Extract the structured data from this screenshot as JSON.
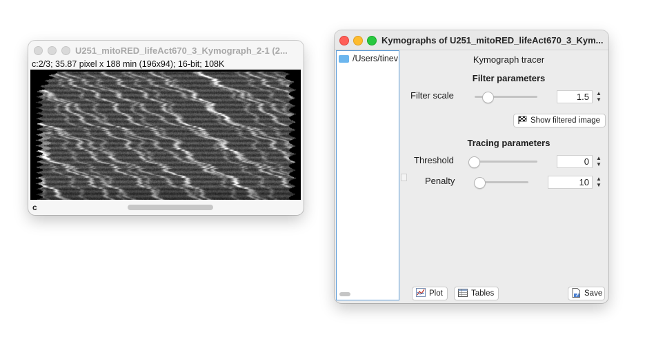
{
  "image_window": {
    "title": "U251_mitoRED_lifeAct670_3_Kymograph_2-1 (2...",
    "info": "c:2/3; 35.87 pixel x 188 min (196x94); 16-bit; 108K",
    "channel_label": "c"
  },
  "tracer_window": {
    "title": "Kymographs of U251_mitoRED_lifeAct670_3_Kym...",
    "tree_path": "/Users/tinev",
    "heading": "Kymograph tracer",
    "filter": {
      "section_title": "Filter parameters",
      "scale_label": "Filter scale",
      "scale_value": "1.5",
      "scale_fraction": 0.1,
      "show_filtered_label": "Show filtered image"
    },
    "tracing": {
      "section_title": "Tracing parameters",
      "threshold_label": "Threshold",
      "threshold_value": "0",
      "threshold_fraction": 0.0,
      "penalty_label": "Penalty",
      "penalty_value": "10",
      "penalty_fraction": 0.05
    },
    "buttons": {
      "plot": "Plot",
      "tables": "Tables",
      "save": "Save"
    }
  }
}
